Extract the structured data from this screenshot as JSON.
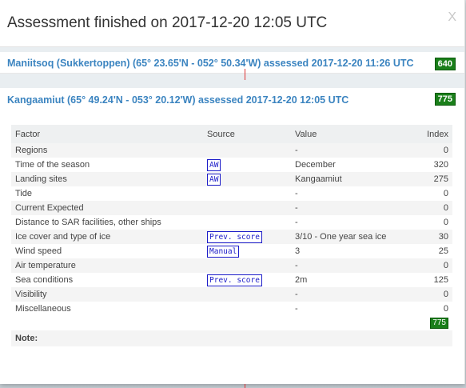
{
  "dialog": {
    "title": "Assessment finished on 2017-12-20 12:05 UTC",
    "close_label": "X"
  },
  "assessments": [
    {
      "label": "Maniitsoq (Sukkertoppen) (65° 23.65'N - 052° 50.34'W) assessed 2017-12-20 11:26 UTC",
      "score": "640"
    },
    {
      "label": "Kangaamiut (65° 49.24'N - 053° 20.12'W) assessed 2017-12-20 12:05 UTC",
      "score": "775"
    }
  ],
  "table": {
    "headers": {
      "factor": "Factor",
      "source": "Source",
      "value": "Value",
      "index": "Index"
    },
    "rows": [
      {
        "factor": "Regions",
        "source": "",
        "value": "-",
        "index": "0"
      },
      {
        "factor": "Time of the season",
        "source": "AW",
        "value": "December",
        "index": "320"
      },
      {
        "factor": "Landing sites",
        "source": "AW",
        "value": "Kangaamiut",
        "index": "275"
      },
      {
        "factor": "Tide",
        "source": "",
        "value": "-",
        "index": "0"
      },
      {
        "factor": "Current Expected",
        "source": "",
        "value": "-",
        "index": "0"
      },
      {
        "factor": "Distance to SAR facilities, other ships",
        "source": "",
        "value": "-",
        "index": "0"
      },
      {
        "factor": "Ice cover and type of ice",
        "source": "Prev. score",
        "value": "3/10 - One year sea ice",
        "index": "30"
      },
      {
        "factor": "Wind speed",
        "source": "Manual",
        "value": "3",
        "index": "25"
      },
      {
        "factor": "Air temperature",
        "source": "",
        "value": "-",
        "index": "0"
      },
      {
        "factor": "Sea conditions",
        "source": "Prev. score",
        "value": "2m",
        "index": "125"
      },
      {
        "factor": "Visibility",
        "source": "",
        "value": "-",
        "index": "0"
      },
      {
        "factor": "Miscellaneous",
        "source": "",
        "value": "-",
        "index": "0"
      }
    ],
    "total": "775",
    "note_label": "Note:"
  },
  "colors": {
    "link": "#3b84c0",
    "score_badge": "#1a7f1a",
    "source_tag": "#1c1cc8"
  }
}
